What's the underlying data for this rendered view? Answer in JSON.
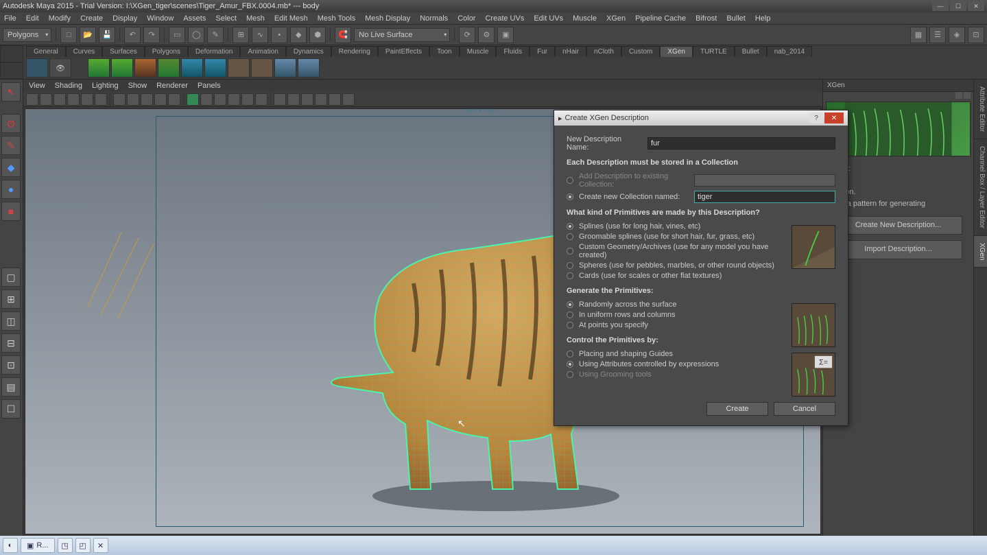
{
  "title": "Autodesk Maya 2015 - Trial Version: I:\\XGen_tiger\\scenes\\Tiger_Amur_FBX.0004.mb*   ---   body",
  "menus": [
    "File",
    "Edit",
    "Modify",
    "Create",
    "Display",
    "Window",
    "Assets",
    "Select",
    "Mesh",
    "Edit Mesh",
    "Mesh Tools",
    "Mesh Display",
    "Normals",
    "Color",
    "Create UVs",
    "Edit UVs",
    "Muscle",
    "XGen",
    "Pipeline Cache",
    "Bifrost",
    "Bullet",
    "Help"
  ],
  "mode_dropdown": "Polygons",
  "live_surface": "No Live Surface",
  "shelf_tabs": [
    "General",
    "Curves",
    "Surfaces",
    "Polygons",
    "Deformation",
    "Animation",
    "Dynamics",
    "Rendering",
    "PaintEffects",
    "Toon",
    "Muscle",
    "Fluids",
    "Fur",
    "nHair",
    "nCloth",
    "Custom",
    "XGen",
    "TURTLE",
    "Bullet",
    "nab_2014"
  ],
  "shelf_active": "XGen",
  "viewport_menus": [
    "View",
    "Shading",
    "Lighting",
    "Show",
    "Renderer",
    "Panels"
  ],
  "gate_label": "750 x 750",
  "right": {
    "tab": "XGen",
    "surface_label": "urface:",
    "hint1": "ntive on.",
    "hint2": "ion is a pattern for generating",
    "btn1": "Create New Description...",
    "btn2": "Import Description..."
  },
  "sidetabs": [
    "Attribute Editor",
    "Channel Box / Layer Editor",
    "XGen"
  ],
  "dialog": {
    "title": "Create XGen Description",
    "name_label": "New Description Name:",
    "name_value": "fur",
    "collection_heading": "Each Description must be stored in a Collection",
    "add_existing_label": "Add Description to existing Collection:",
    "create_new_label": "Create new Collection named:",
    "create_new_value": "tiger",
    "primitives_heading": "What kind of Primitives are made by this Description?",
    "prim_opts": [
      "Splines (use for long hair, vines, etc)",
      "Groomable splines (use for short hair, fur, grass, etc)",
      "Custom Geometry/Archives (use for any model you have created)",
      "Spheres (use for pebbles, marbles, or other round objects)",
      "Cards (use for scales or other flat textures)"
    ],
    "generate_heading": "Generate the Primitives:",
    "gen_opts": [
      "Randomly across the surface",
      "In uniform rows and columns",
      "At points you specify"
    ],
    "control_heading": "Control the Primitives by:",
    "ctrl_opts": [
      "Placing and shaping Guides",
      "Using Attributes controlled by expressions",
      "Using Grooming tools"
    ],
    "create": "Create",
    "cancel": "Cancel"
  },
  "taskbar_item": "R..."
}
